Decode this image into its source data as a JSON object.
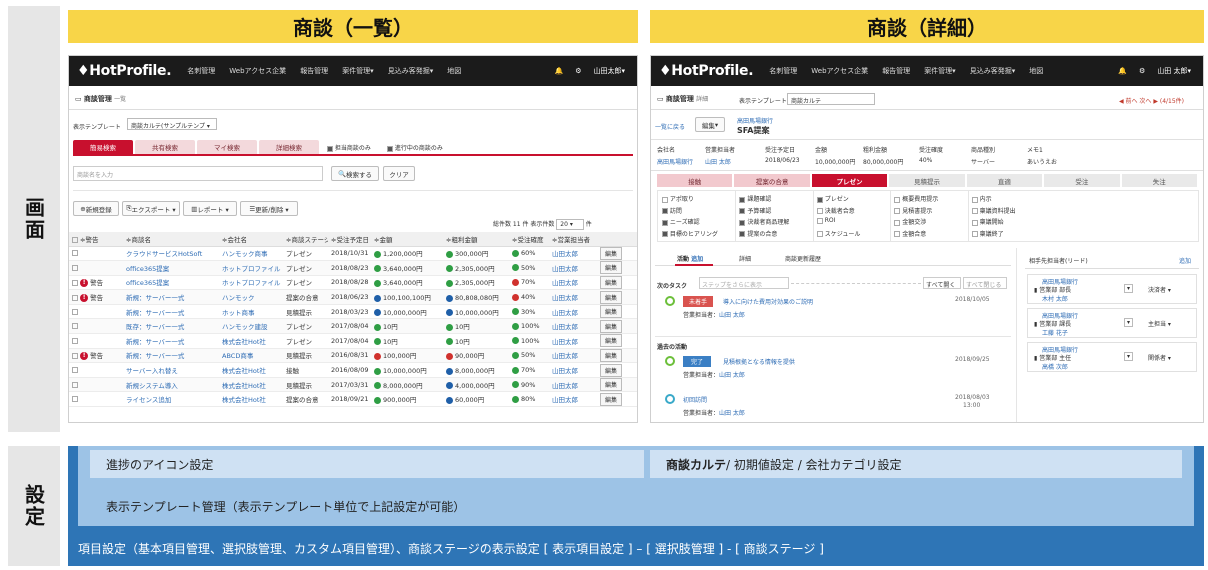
{
  "labels": {
    "screen": "画面",
    "settings": "設定"
  },
  "titles": {
    "list": "商談（一覧）",
    "detail": "商談（詳細）"
  },
  "colors": {
    "accent_red": "#c8102e",
    "title_yellow": "#f8d548",
    "settings_light": "#cfe1f3",
    "settings_mid": "#9dc3e6",
    "settings_dark": "#2e75b6"
  },
  "list_screen": {
    "logo": "♦HotProfile.",
    "nav": [
      "名刺管理",
      "Webアクセス企業",
      "報告管理",
      "案件管理▾",
      "見込み客発掘▾",
      "地図"
    ],
    "user": "山田太郎▾",
    "page_title": "商談管理",
    "page_sub": "一覧",
    "template_label": "表示テンプレート",
    "template_value": "商談カルテ(サンプルテンプ",
    "tabs": [
      "簡易検索",
      "共有検索",
      "マイ検索",
      "詳細検索"
    ],
    "filters": [
      "担当商談のみ",
      "進行中の商談のみ"
    ],
    "search_placeholder": "商談名を入力",
    "search_button": "検索する",
    "clear_button": "クリア",
    "actions": [
      "新規登録",
      "エクスポート ▾",
      "レポート ▾",
      "更新/削除 ▾"
    ],
    "count_text": "総件数 11 件 表示件数",
    "page_size": "20",
    "page_size_unit": "件",
    "columns": [
      "警告",
      "商談名",
      "会社名",
      "商談ステージ",
      "受注予定日",
      "金額",
      "粗利金額",
      "受注確度",
      "営業担当者",
      ""
    ],
    "rows": [
      {
        "warn": "",
        "name": "クラウドサービスHotSoft",
        "company": "ハンモック商事",
        "stage": "プレゼン",
        "date": "2018/10/31",
        "amount": "1,200,000円",
        "amount_icon": "green",
        "gross": "300,000円",
        "gross_icon": "green",
        "prob": "60%",
        "prob_icon": "green",
        "rep": "山田太郎",
        "edit": "編集"
      },
      {
        "warn": "",
        "name": "office365提案",
        "company": "ホットプロファイル",
        "stage": "プレゼン",
        "date": "2018/08/23",
        "amount": "3,640,000円",
        "amount_icon": "green",
        "gross": "2,305,000円",
        "gross_icon": "green",
        "prob": "50%",
        "prob_icon": "green",
        "rep": "山田太郎",
        "edit": "編集"
      },
      {
        "warn": "警告",
        "name": "office365提案",
        "company": "ホットプロファイル",
        "stage": "プレゼン",
        "date": "2018/08/28",
        "amount": "3,640,000円",
        "amount_icon": "green",
        "gross": "2,305,000円",
        "gross_icon": "green",
        "prob": "70%",
        "prob_icon": "red",
        "rep": "山田太郎",
        "edit": "編集"
      },
      {
        "warn": "警告",
        "name": "新規：サーバー一式",
        "company": "ハンモック",
        "stage": "提案の合意",
        "date": "2018/06/23",
        "amount": "100,100,100円",
        "amount_icon": "blue",
        "gross": "80,808,080円",
        "gross_icon": "blue",
        "prob": "40%",
        "prob_icon": "red",
        "rep": "山田太郎",
        "edit": "編集"
      },
      {
        "warn": "",
        "name": "新規：サーバー一式",
        "company": "ホット商事",
        "stage": "見積提示",
        "date": "2018/03/23",
        "amount": "10,000,000円",
        "amount_icon": "blue",
        "gross": "10,000,000円",
        "gross_icon": "blue",
        "prob": "30%",
        "prob_icon": "green",
        "rep": "山田太郎",
        "edit": "編集"
      },
      {
        "warn": "",
        "name": "既存：サーバー一式",
        "company": "ハンモック建設",
        "stage": "プレゼン",
        "date": "2017/08/04",
        "amount": "10円",
        "amount_icon": "green",
        "gross": "10円",
        "gross_icon": "green",
        "prob": "100%",
        "prob_icon": "green",
        "rep": "山田太郎",
        "edit": "編集"
      },
      {
        "warn": "",
        "name": "新規：サーバー一式",
        "company": "株式会社Hot社",
        "stage": "プレゼン",
        "date": "2017/08/04",
        "amount": "10円",
        "amount_icon": "green",
        "gross": "10円",
        "gross_icon": "green",
        "prob": "100%",
        "prob_icon": "green",
        "rep": "山田太郎",
        "edit": "編集"
      },
      {
        "warn": "警告",
        "name": "新規：サーバー一式",
        "company": "ABCD商事",
        "stage": "見積提示",
        "date": "2016/08/31",
        "amount": "100,000円",
        "amount_icon": "red",
        "gross": "90,000円",
        "gross_icon": "red",
        "prob": "50%",
        "prob_icon": "green",
        "rep": "山田太郎",
        "edit": "編集"
      },
      {
        "warn": "",
        "name": "サーバー入れ替え",
        "company": "株式会社Hot社",
        "stage": "接触",
        "date": "2016/08/09",
        "amount": "10,000,000円",
        "amount_icon": "green",
        "gross": "8,000,000円",
        "gross_icon": "blue",
        "prob": "70%",
        "prob_icon": "green",
        "rep": "山田太郎",
        "edit": "編集"
      },
      {
        "warn": "",
        "name": "新規システム導入",
        "company": "株式会社Hot社",
        "stage": "見積提示",
        "date": "2017/03/31",
        "amount": "8,000,000円",
        "amount_icon": "green",
        "gross": "4,000,000円",
        "gross_icon": "blue",
        "prob": "90%",
        "prob_icon": "green",
        "rep": "山田太郎",
        "edit": "編集"
      },
      {
        "warn": "",
        "name": "ライセンス追加",
        "company": "株式会社Hot社",
        "stage": "提案の合意",
        "date": "2018/09/21",
        "amount": "900,000円",
        "amount_icon": "green",
        "gross": "60,000円",
        "gross_icon": "blue",
        "prob": "80%",
        "prob_icon": "green",
        "rep": "山田太郎",
        "edit": "編集"
      }
    ]
  },
  "detail_screen": {
    "logo": "♦HotProfile.",
    "nav": [
      "名刺管理",
      "Webアクセス企業",
      "報告管理",
      "案件管理▾",
      "見込み客発掘▾",
      "地図"
    ],
    "user": "山田 太郎▾",
    "page_title": "商談管理",
    "page_sub": "詳細",
    "template_label": "表示テンプレート",
    "template_value": "商談カルテ",
    "pager": "◀ 前へ 次へ ▶ (4/15件)",
    "back": "一覧に戻る",
    "edit": "編集",
    "company_link": "高田馬場銀行",
    "deal_name": "SFA提案",
    "info_labels": [
      "会社名",
      "営業担当者",
      "受注予定日",
      "金額",
      "粗利金額",
      "受注確度",
      "商品種別",
      "メモ1"
    ],
    "info_values": [
      "高田馬場銀行",
      "山田 太郎",
      "2018/06/23",
      "10,000,000円",
      "80,000,000円",
      "40%",
      "サーバー",
      "あいうえお"
    ],
    "stages": [
      "接触",
      "提案の合意",
      "プレゼン",
      "見積提示",
      "直適",
      "受注",
      "失注"
    ],
    "checklists": [
      [
        "アポ取り",
        "訪問",
        "ニーズ確認",
        "目標のヒアリング"
      ],
      [
        "課題確認",
        "予算確認",
        "決裁者商品理解",
        "提案の合意"
      ],
      [
        "プレゼン",
        "決裁者合意",
        "ROI",
        "スケジュール"
      ],
      [
        "概要費用提示",
        "見積書提示",
        "金額交渉",
        "金額合意"
      ],
      [
        "内示",
        "稟議資料提出",
        "稟議開始",
        "稟議終了"
      ]
    ],
    "activity_tabs": [
      "活動",
      "追加",
      "詳細",
      "商談更新履歴"
    ],
    "next_tasks_label": "次のタスク",
    "step_placeholder": "ステップをさらに表示",
    "open_all": "すべて開く",
    "close_all": "すべて閉じる",
    "next_task": {
      "status": "未着手",
      "title": "導入に向けた費用対効果のご説明",
      "date": "2018/10/05",
      "rep_label": "営業担当者：",
      "rep": "山田 太郎"
    },
    "past_label": "過去の活動",
    "past_tasks": [
      {
        "status": "完了",
        "title": "見積根拠となる情報を提供",
        "date": "2018/09/25",
        "rep_label": "営業担当者：",
        "rep": "山田 太郎"
      },
      {
        "status": "",
        "title": "初回訪問",
        "date": "2018/08/03",
        "time": "13:00",
        "rep_label": "営業担当者：",
        "rep": "山田 太郎"
      }
    ],
    "contacts_title": "相手先担当者(リード)",
    "contacts_add": "追加",
    "contacts": [
      {
        "company": "高田馬場銀行",
        "dept": "営業部 部長",
        "name": "木村 太郎",
        "role": "決済者"
      },
      {
        "company": "高田馬場銀行",
        "dept": "営業部 課長",
        "name": "工藤 花子",
        "role": "主担当"
      },
      {
        "company": "高田馬場銀行",
        "dept": "営業部 主任",
        "name": "高橋 次郎",
        "role": "関係者"
      }
    ]
  },
  "settings": {
    "icon_setting": "進捗のアイコン設定",
    "karte_bold": "商談カルテ",
    "karte_rest": " / 初期値設定 / 会社カテゴリ設定",
    "template_mgmt": "表示テンプレート管理（表示テンプレート単位で上記設定が可能）",
    "item_settings": "項目設定（基本項目管理、選択肢管理、カスタム項目管理）、商談ステージの表示設定 [ 表示項目設定 ] – [ 選択肢管理 ] - [ 商談ステージ ]"
  }
}
